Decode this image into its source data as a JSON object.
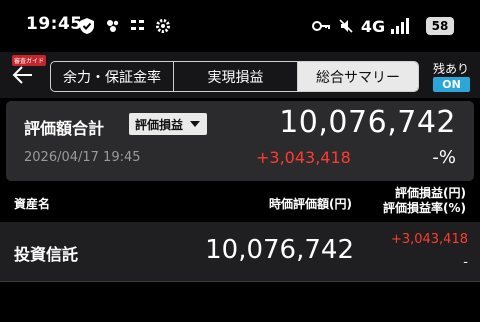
{
  "status_bar": {
    "time": "19:45",
    "network": "4G",
    "battery": "58",
    "icons": [
      "shield-check-icon",
      "pinwheel-icon",
      "brand-logo-icon",
      "gear-icon",
      "key-icon",
      "mute-icon",
      "signal-icon",
      "battery-icon"
    ]
  },
  "nav": {
    "badge": "審査ガイド",
    "back_icon": "back-arrow-icon",
    "tabs": [
      {
        "label": "余力・保証金率",
        "active": false
      },
      {
        "label": "実現損益",
        "active": false
      },
      {
        "label": "総合サマリー",
        "active": true
      }
    ],
    "zandaka_label": "残あり",
    "zandaka_toggle": "ON"
  },
  "summary": {
    "title": "評価額合計",
    "dropdown_value": "評価損益",
    "total_value": "10,076,742",
    "date": "2026/04/17  19:45",
    "profit": "+3,043,418",
    "rate": "-%"
  },
  "table": {
    "headers": {
      "name": "資産名",
      "market_value": "時価評価額(円)",
      "profit": "評価損益(円)",
      "rate": "評価損益率(%)"
    },
    "rows": [
      {
        "name": "投資信託",
        "value": "10,076,742",
        "profit": "+3,043,418",
        "rate": "-"
      }
    ]
  },
  "colors": {
    "background": "#000000",
    "card": "#2b2b2d",
    "profit_red": "#ff3b30",
    "toggle_blue": "#2aa7d8"
  }
}
